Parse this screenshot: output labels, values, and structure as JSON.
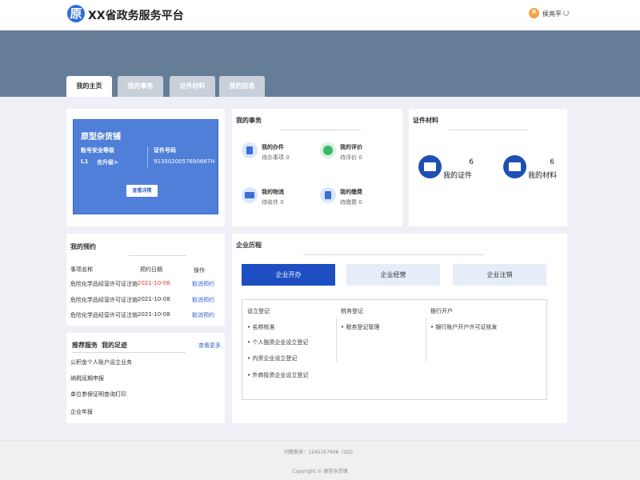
{
  "header": {
    "logo_char": "原",
    "title": "XX省政务服务平台",
    "user_name": "侯亮平"
  },
  "tabs": [
    {
      "label": "我的主页"
    },
    {
      "label": "我的事务"
    },
    {
      "label": "证件材料"
    },
    {
      "label": "我的信息"
    }
  ],
  "profile": {
    "name": "原型杂货铺",
    "security_label": "账号安全等级",
    "security_level": "L1",
    "upgrade_label": "去升级>",
    "cert_label": "证件号码",
    "cert_number": "913502005769066​7H",
    "detail_button": "查看详情"
  },
  "affairs": {
    "title": "我的事务",
    "items": [
      {
        "label": "我的办件",
        "sub": "待办事项  0"
      },
      {
        "label": "我的评价",
        "sub": "待评价  0"
      },
      {
        "label": "我的物流",
        "sub": "待收件  0"
      },
      {
        "label": "我的缴费",
        "sub": "待缴费  0"
      }
    ]
  },
  "certificates": {
    "title": "证件材料",
    "items": [
      {
        "label": "我的证件",
        "count": "6"
      },
      {
        "label": "我的材料",
        "count": "6"
      }
    ]
  },
  "appointments": {
    "title": "我的预约",
    "headers": {
      "name": "事项名称",
      "date": "预约日期",
      "action": "操作"
    },
    "rows": [
      {
        "name": "危险化学品经营许可证注销",
        "date": "2021-10-08",
        "action": "取消预约"
      },
      {
        "name": "危险化学品经营许可证注销",
        "date": "2021-10-08",
        "action": "取消预约"
      },
      {
        "name": "危险化学品经营许可证注销",
        "date": "2021-10-08",
        "action": "取消预约"
      }
    ]
  },
  "recommend": {
    "tab1": "推荐服务",
    "tab2": "我的足迹",
    "more": "查看更多",
    "items": [
      "公积金个人账户设立业务",
      "纳税延期申报",
      "单位参保证明查询打印",
      "企业年报"
    ]
  },
  "history": {
    "title": "企业历程",
    "buttons": [
      "企业开办",
      "企业经营",
      "企业注销"
    ],
    "columns": [
      {
        "title": "设立登记",
        "items": [
          "• 名称核准",
          "• 个人独资企业设立登记",
          "• 内资企业设立登记",
          "• 外商投资企业设立登记"
        ]
      },
      {
        "title": "税务登记",
        "items": [
          "• 税务登记管理"
        ]
      },
      {
        "title": "银行开户",
        "items": [
          "• 银行账户开户许可证核发"
        ]
      }
    ]
  },
  "footer": {
    "contact": "问题联系：1245357606（QQ）",
    "copyright": "Copyright © 原型杂货铺"
  },
  "colors": {
    "banner": "#667d98",
    "primary": "#1d4fc2",
    "profile_bg": "#4f7fd9"
  }
}
